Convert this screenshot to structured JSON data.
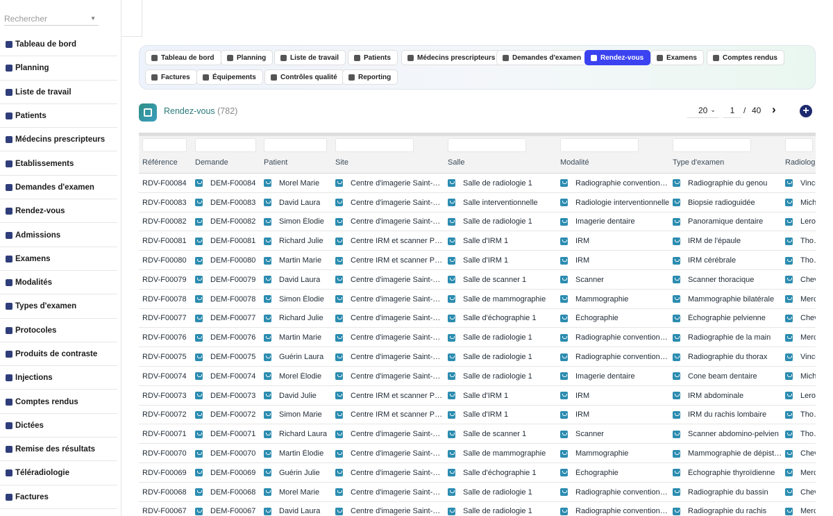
{
  "search": {
    "placeholder": "Rechercher"
  },
  "sidebar": {
    "items": [
      {
        "label": "Tableau de bord",
        "icon": "dashboard-icon"
      },
      {
        "label": "Planning",
        "icon": "calendar-icon"
      },
      {
        "label": "Liste de travail",
        "icon": "worklist-icon"
      },
      {
        "label": "Patients",
        "icon": "patient-icon"
      },
      {
        "label": "Médecins prescripteurs",
        "icon": "doctor-icon"
      },
      {
        "label": "Établissements",
        "icon": "building-icon"
      },
      {
        "label": "Demandes d'examen",
        "icon": "request-icon"
      },
      {
        "label": "Rendez-vous",
        "icon": "appointment-icon"
      },
      {
        "label": "Admissions",
        "icon": "id-card-icon"
      },
      {
        "label": "Examens",
        "icon": "exam-icon"
      },
      {
        "label": "Modalités",
        "icon": "modality-icon"
      },
      {
        "label": "Types d'examen",
        "icon": "exam-type-icon"
      },
      {
        "label": "Protocoles",
        "icon": "protocol-icon"
      },
      {
        "label": "Produits de contraste",
        "icon": "contrast-icon"
      },
      {
        "label": "Injections",
        "icon": "syringe-icon"
      },
      {
        "label": "Comptes rendus",
        "icon": "report-icon"
      },
      {
        "label": "Dictées",
        "icon": "microphone-icon"
      },
      {
        "label": "Remise des résultats",
        "icon": "printer-icon"
      },
      {
        "label": "Téléradiologie",
        "icon": "broadcast-icon"
      },
      {
        "label": "Factures",
        "icon": "invoice-icon"
      }
    ]
  },
  "tabs": [
    {
      "label": "Tableau de bord",
      "icon": "dashboard-icon"
    },
    {
      "label": "Planning",
      "icon": "calendar-icon"
    },
    {
      "label": "Liste de travail",
      "icon": "worklist-icon"
    },
    {
      "label": "Patients",
      "icon": "patient-icon"
    },
    {
      "label": "Médecins prescripteurs",
      "icon": "doctor-icon"
    },
    {
      "label": "Demandes d'examen",
      "icon": "request-icon"
    },
    {
      "label": "Rendez-vous",
      "icon": "appointment-icon",
      "active": true
    },
    {
      "label": "Examens",
      "icon": "exam-icon"
    },
    {
      "label": "Comptes rendus",
      "icon": "report-icon"
    },
    {
      "label": "Factures",
      "icon": "invoice-icon"
    },
    {
      "label": "Équipements",
      "icon": "gears-icon"
    },
    {
      "label": "Contrôles qualité",
      "icon": "quality-icon"
    },
    {
      "label": "Reporting",
      "icon": "pie-chart-icon"
    }
  ],
  "header": {
    "title": "Rendez-vous",
    "count": "(782)"
  },
  "pagination": {
    "per_page": "20",
    "page": "1",
    "separator": "/",
    "total_pages": "40"
  },
  "table": {
    "columns": [
      "Référence",
      "Demande",
      "Patient",
      "Site",
      "Salle",
      "Modalité",
      "Type d'examen",
      "Radiologue"
    ],
    "rows": [
      [
        "RDV-F00084",
        "DEM-F00084",
        "Morel Marie",
        "Centre d'imagerie Saint-Michel",
        "Salle de radiologie 1",
        "Radiographie conventionnelle",
        "Radiographie du genou",
        "Vincent"
      ],
      [
        "RDV-F00083",
        "DEM-F00083",
        "David Laura",
        "Centre d'imagerie Saint-Michel",
        "Salle interventionnelle",
        "Radiologie interventionnelle",
        "Biopsie radioguidée",
        "Michel"
      ],
      [
        "RDV-F00082",
        "DEM-F00082",
        "Simon Élodie",
        "Centre d'imagerie Saint-Michel",
        "Salle de radiologie 1",
        "Imagerie dentaire",
        "Panoramique dentaire",
        "Leroy"
      ],
      [
        "RDV-F00081",
        "DEM-F00081",
        "Richard Julie",
        "Centre IRM et scanner Pasteur",
        "Salle d'IRM 1",
        "IRM",
        "IRM de l'épaule",
        "Thomas"
      ],
      [
        "RDV-F00080",
        "DEM-F00080",
        "Martin Marie",
        "Centre IRM et scanner Pasteur",
        "Salle d'IRM 1",
        "IRM",
        "IRM cérébrale",
        "Thomas"
      ],
      [
        "RDV-F00079",
        "DEM-F00079",
        "David Laura",
        "Centre d'imagerie Saint-Michel",
        "Salle de scanner 1",
        "Scanner",
        "Scanner thoracique",
        "Chevalier"
      ],
      [
        "RDV-F00078",
        "DEM-F00078",
        "Simon Élodie",
        "Centre d'imagerie Saint-Michel",
        "Salle de mammographie",
        "Mammographie",
        "Mammographie bilatérale",
        "Mercier"
      ],
      [
        "RDV-F00077",
        "DEM-F00077",
        "Richard Julie",
        "Centre d'imagerie Saint-Michel",
        "Salle d'échographie 1",
        "Échographie",
        "Échographie pelvienne",
        "Chevalier"
      ],
      [
        "RDV-F00076",
        "DEM-F00076",
        "Martin Marie",
        "Centre d'imagerie Saint-Michel",
        "Salle de radiologie 1",
        "Radiographie conventionnelle",
        "Radiographie de la main",
        "Mercier"
      ],
      [
        "RDV-F00075",
        "DEM-F00075",
        "Guérin Laura",
        "Centre d'imagerie Saint-Michel",
        "Salle de radiologie 1",
        "Radiographie conventionnelle",
        "Radiographie du thorax",
        "Vincent"
      ],
      [
        "RDV-F00074",
        "DEM-F00074",
        "Morel Élodie",
        "Centre d'imagerie Saint-Michel",
        "Salle de radiologie 1",
        "Imagerie dentaire",
        "Cone beam dentaire",
        "Michel"
      ],
      [
        "RDV-F00073",
        "DEM-F00073",
        "David Julie",
        "Centre IRM et scanner Pasteur",
        "Salle d'IRM 1",
        "IRM",
        "IRM abdominale",
        "Leroy"
      ],
      [
        "RDV-F00072",
        "DEM-F00072",
        "Simon Marie",
        "Centre IRM et scanner Pasteur",
        "Salle d'IRM 1",
        "IRM",
        "IRM du rachis lombaire",
        "Thomas"
      ],
      [
        "RDV-F00071",
        "DEM-F00071",
        "Richard Laura",
        "Centre d'imagerie Saint-Michel",
        "Salle de scanner 1",
        "Scanner",
        "Scanner abdomino-pelvien",
        "Thomas"
      ],
      [
        "RDV-F00070",
        "DEM-F00070",
        "Martin Élodie",
        "Centre d'imagerie Saint-Michel",
        "Salle de mammographie",
        "Mammographie",
        "Mammographie de dépistage",
        "Chevalier"
      ],
      [
        "RDV-F00069",
        "DEM-F00069",
        "Guérin Julie",
        "Centre d'imagerie Saint-Michel",
        "Salle d'échographie 1",
        "Échographie",
        "Échographie thyroïdienne",
        "Mercier"
      ],
      [
        "RDV-F00068",
        "DEM-F00068",
        "Morel Marie",
        "Centre d'imagerie Saint-Michel",
        "Salle de radiologie 1",
        "Radiographie conventionnelle",
        "Radiographie du bassin",
        "Chevalier"
      ],
      [
        "RDV-F00067",
        "DEM-F00067",
        "David Laura",
        "Centre d'imagerie Saint-Michel",
        "Salle de radiologie 1",
        "Radiographie conventionnelle",
        "Radiographie du rachis",
        "Mercier"
      ]
    ]
  },
  "colors": {
    "accent": "#3b42f0",
    "sidebar_icon": "#2f3e7a",
    "relation_icon": "#2c8cb0",
    "title": "#2b7a7a",
    "add_button": "#1e2a6e"
  }
}
